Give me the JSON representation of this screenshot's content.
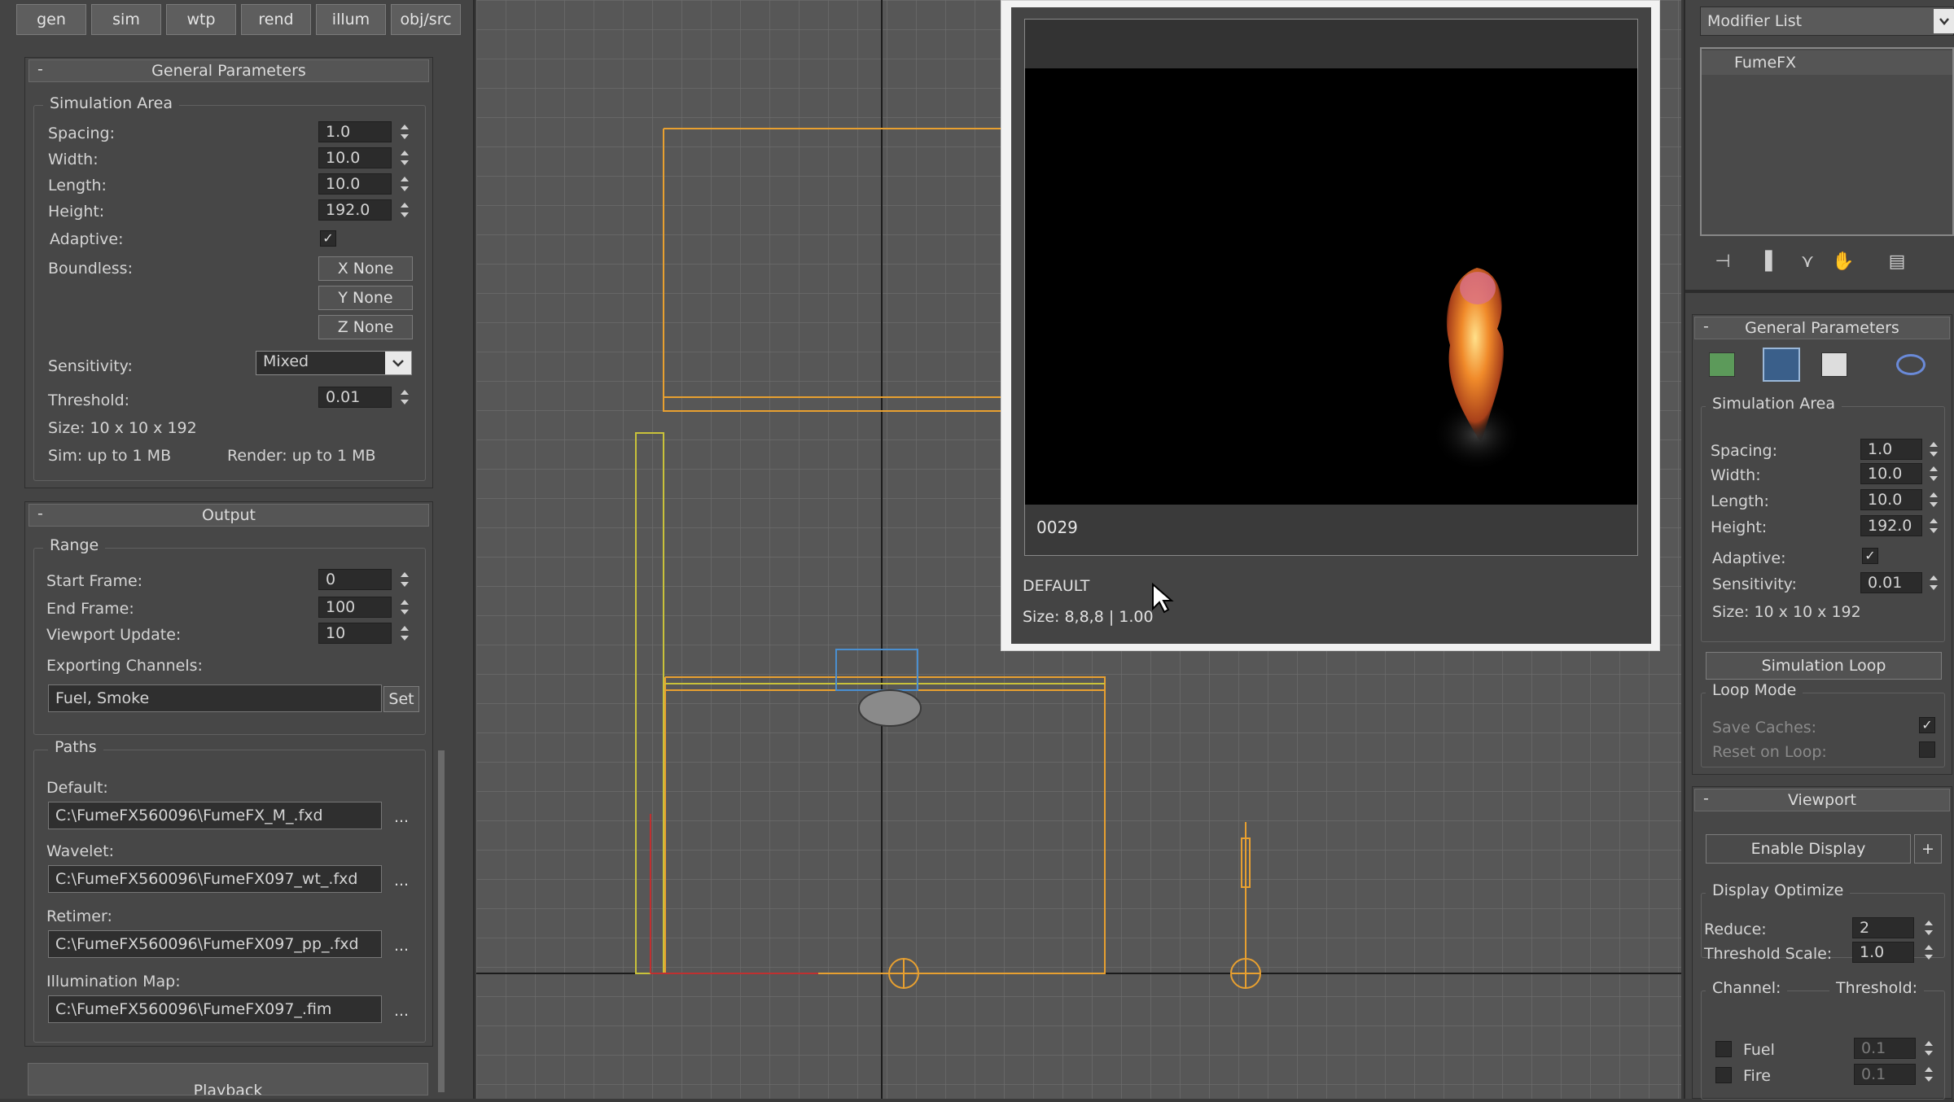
{
  "left_tabs": [
    "gen",
    "sim",
    "wtp",
    "rend",
    "illum",
    "obj/src"
  ],
  "general": {
    "header": "General Parameters",
    "collapse": "-",
    "sim_area_label": "Simulation Area",
    "spacing_label": "Spacing:",
    "spacing": "1.0",
    "width_label": "Width:",
    "width": "10.0",
    "length_label": "Length:",
    "length": "10.0",
    "height_label": "Height:",
    "height": "192.0",
    "adaptive_label": "Adaptive:",
    "adaptive_check": "✓",
    "boundless_label": "Boundless:",
    "x_none": "X None",
    "y_none": "Y None",
    "z_none": "Z None",
    "sensitivity_label": "Sensitivity:",
    "sensitivity": "Mixed",
    "threshold_label": "Threshold:",
    "threshold": "0.01",
    "size_text": "Size: 10 x 10 x 192",
    "sim_mem": "Sim: up to 1 MB",
    "render_mem": "Render: up to 1 MB"
  },
  "output": {
    "header": "Output",
    "collapse": "-",
    "range_label": "Range",
    "start_label": "Start Frame:",
    "start": "0",
    "end_label": "End Frame:",
    "end": "100",
    "vpupdate_label": "Viewport Update:",
    "vpupdate": "10",
    "exporting_label": "Exporting Channels:",
    "channels": "Fuel, Smoke",
    "set_btn": "Set",
    "paths_label": "Paths",
    "default_label": "Default:",
    "default_path": "C:\\FumeFX560096\\FumeFX_M_.fxd",
    "wavelet_label": "Wavelet:",
    "wavelet_path": "C:\\FumeFX560096\\FumeFX097_wt_.fxd",
    "retimer_label": "Retimer:",
    "retimer_path": "C:\\FumeFX560096\\FumeFX097_pp_.fxd",
    "illum_label": "Illumination Map:",
    "illum_path": "C:\\FumeFX560096\\FumeFX097_.fim",
    "browse": "..."
  },
  "playback_header": "Playback",
  "preview": {
    "frame": "0029",
    "name": "DEFAULT",
    "size": "Size: 8,8,8 | 1.00"
  },
  "right": {
    "modifier_list": "Modifier List",
    "stack_item": "FumeFX",
    "gp_header": "General Parameters",
    "collapse": "-",
    "sim_area_label": "Simulation Area",
    "spacing_label": "Spacing:",
    "spacing": "1.0",
    "width_label": "Width:",
    "width": "10.0",
    "length_label": "Length:",
    "length": "10.0",
    "height_label": "Height:",
    "height": "192.0",
    "adaptive_label": "Adaptive:",
    "adaptive_check": "✓",
    "sensitivity_label": "Sensitivity:",
    "sensitivity": "0.01",
    "size_text": "Size:   10 x 10 x 192",
    "sim_loop_btn": "Simulation Loop",
    "loop_mode_label": "Loop Mode",
    "save_caches_label": "Save Caches:",
    "save_caches_check": "✓",
    "reset_loop_label": "Reset on Loop:",
    "viewport_header": "Viewport",
    "enable_display": "Enable Display",
    "plus": "+",
    "display_opt_label": "Display Optimize",
    "reduce_label": "Reduce:",
    "reduce": "2",
    "thresh_scale_label": "Threshold Scale:",
    "thresh_scale": "1.0",
    "channel_label": "Channel:",
    "threshold_label": "Threshold:",
    "fuel_label": "Fuel",
    "fuel_val": "0.1",
    "fire_label": "Fire",
    "fire_val": "0.1"
  },
  "colors": {
    "accent": "#e8a030",
    "grid": "#6a6a6a",
    "axis": "#1c1c1c"
  }
}
